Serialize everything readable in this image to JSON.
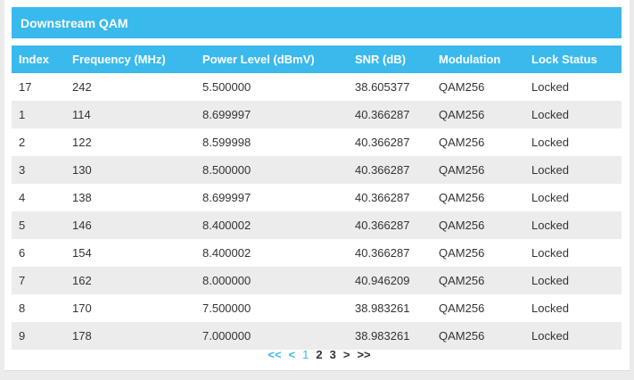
{
  "title": "Downstream QAM",
  "columns": [
    "Index",
    "Frequency (MHz)",
    "Power Level (dBmV)",
    "SNR (dB)",
    "Modulation",
    "Lock Status"
  ],
  "rows": [
    [
      "17",
      "242",
      "5.500000",
      "38.605377",
      "QAM256",
      "Locked"
    ],
    [
      "1",
      "114",
      "8.699997",
      "40.366287",
      "QAM256",
      "Locked"
    ],
    [
      "2",
      "122",
      "8.599998",
      "40.366287",
      "QAM256",
      "Locked"
    ],
    [
      "3",
      "130",
      "8.500000",
      "40.366287",
      "QAM256",
      "Locked"
    ],
    [
      "4",
      "138",
      "8.699997",
      "40.366287",
      "QAM256",
      "Locked"
    ],
    [
      "5",
      "146",
      "8.400002",
      "40.366287",
      "QAM256",
      "Locked"
    ],
    [
      "6",
      "154",
      "8.400002",
      "40.366287",
      "QAM256",
      "Locked"
    ],
    [
      "7",
      "162",
      "8.000000",
      "40.946209",
      "QAM256",
      "Locked"
    ],
    [
      "8",
      "170",
      "7.500000",
      "38.983261",
      "QAM256",
      "Locked"
    ],
    [
      "9",
      "178",
      "7.000000",
      "38.983261",
      "QAM256",
      "Locked"
    ]
  ],
  "pager": {
    "first": "<<",
    "prev": "<",
    "pages": [
      "1",
      "2",
      "3"
    ],
    "current_page": "1",
    "next": ">",
    "last": ">>"
  },
  "colors": {
    "accent": "#3ab9ec",
    "row_alt": "#ececec"
  }
}
